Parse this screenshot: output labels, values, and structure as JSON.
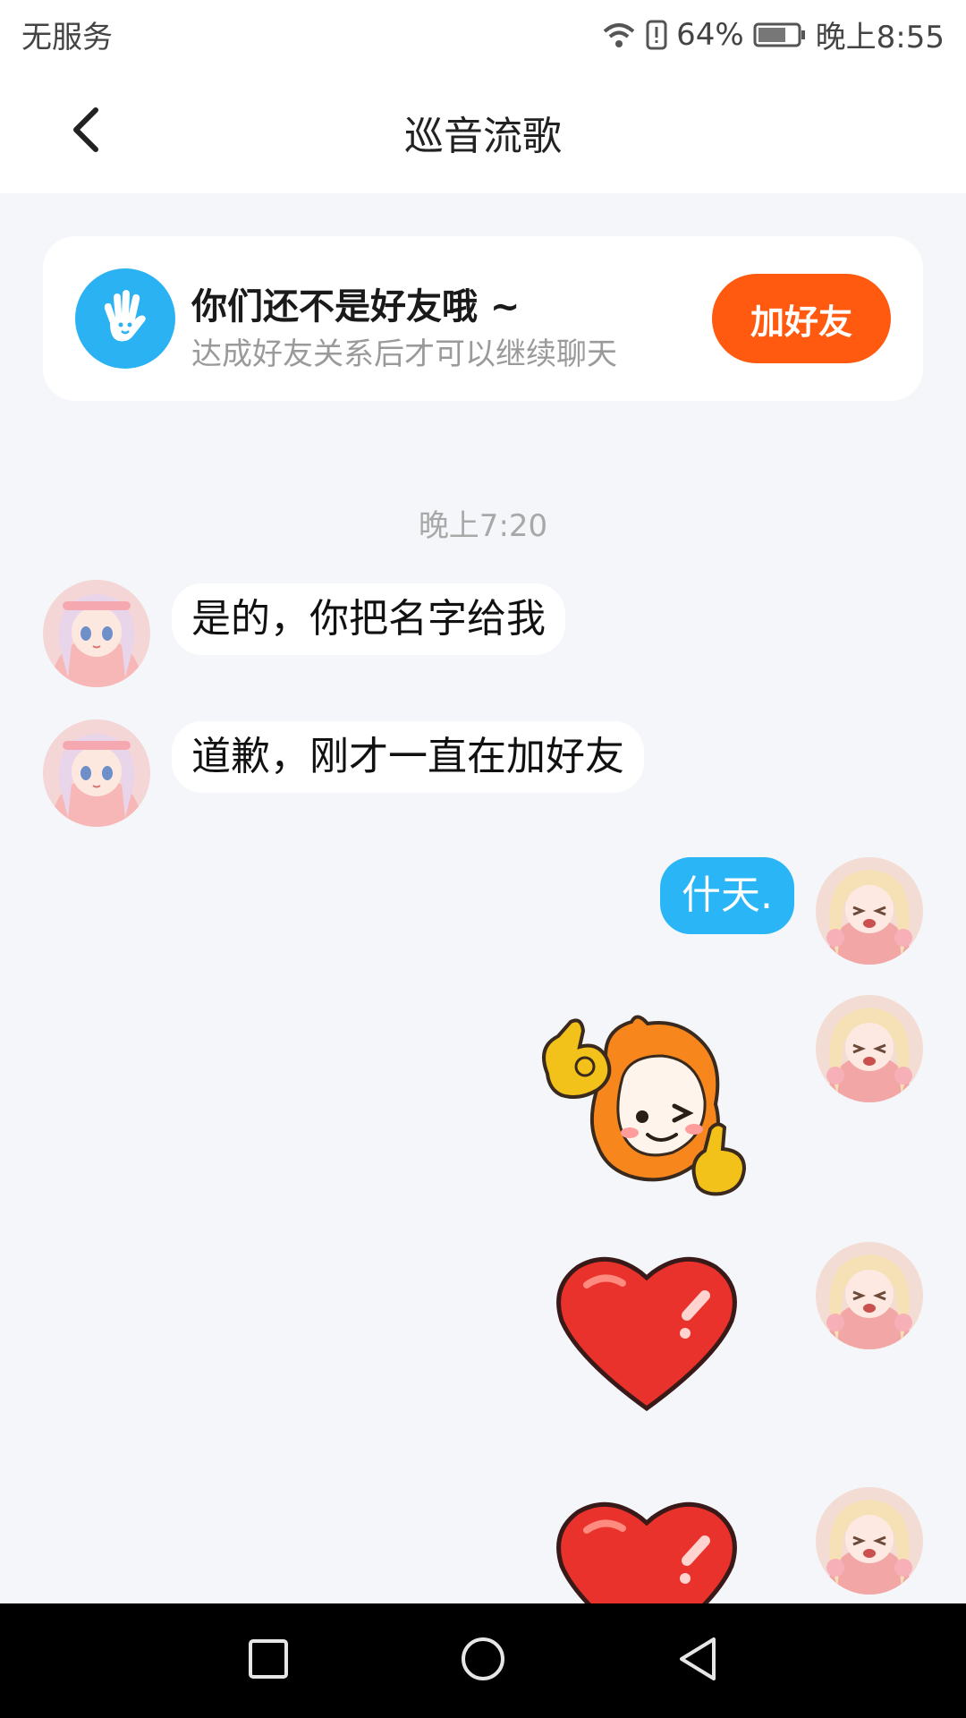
{
  "status_bar": {
    "carrier": "无服务",
    "battery": "64%",
    "time": "晚上8:55"
  },
  "header": {
    "title": "巡音流歌"
  },
  "friend_notice": {
    "title": "你们还不是好友哦 ~",
    "subtitle": "达成好友关系后才可以继续聊天",
    "button_label": "加好友"
  },
  "chat": {
    "timestamp": "晚上7:20",
    "messages": [
      {
        "side": "left",
        "type": "text",
        "text": "是的，你把名字给我"
      },
      {
        "side": "left",
        "type": "text",
        "text": "道歉，刚才一直在加好友"
      },
      {
        "side": "right",
        "type": "text",
        "text": "什天."
      },
      {
        "side": "right",
        "type": "sticker",
        "sticker": "ok-thumbs-up-sticker"
      },
      {
        "side": "right",
        "type": "sticker",
        "sticker": "heart-sticker"
      },
      {
        "side": "right",
        "type": "sticker",
        "sticker": "heart-sticker"
      }
    ]
  },
  "colors": {
    "accent_blue": "#29b5f6",
    "accent_orange": "#ff5a0f",
    "background": "#f4f6f9"
  }
}
